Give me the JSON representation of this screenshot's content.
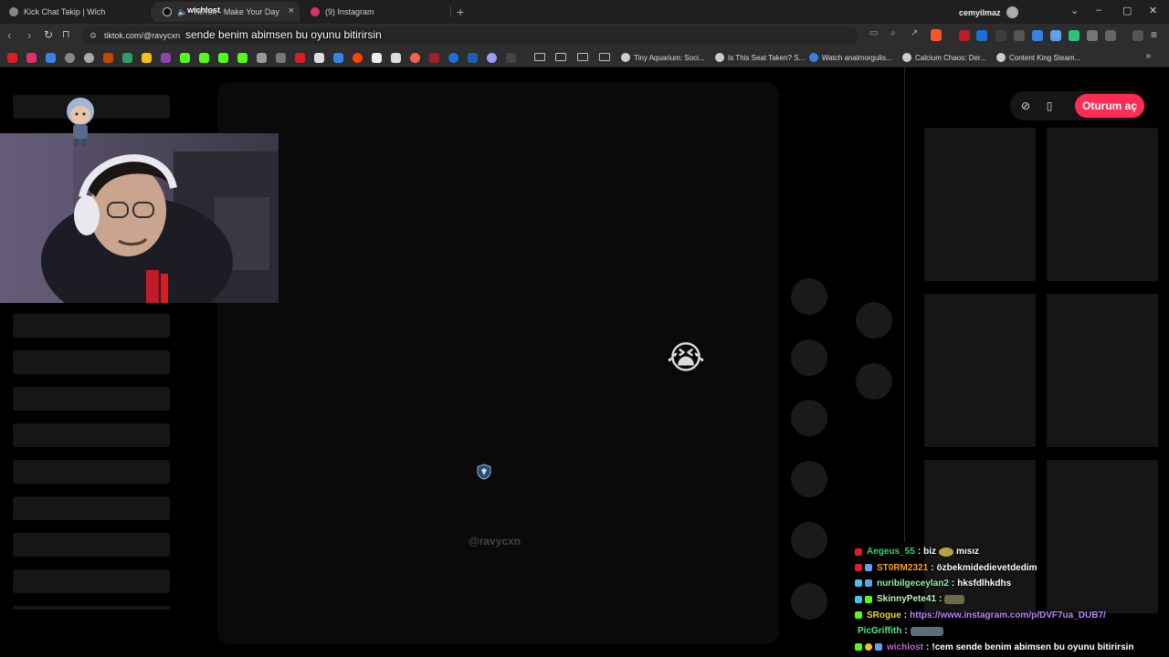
{
  "browser": {
    "tabs": [
      {
        "label": "Kick Chat Takip | Wich",
        "active": false
      },
      {
        "label": "TikTok - Make Your Day",
        "active": true
      },
      {
        "label": "(9) Instagram",
        "active": false
      }
    ],
    "tab_overlay_label": "wichlost",
    "profile_name": "cemyilmaz",
    "url": "tiktok.com/@ravycxn",
    "bookmarks": [
      "Tiny Aquarium: Soci...",
      "Is This Seat Taken? S...",
      "Watch analmorgulis...",
      "Calcium Chaos: Der...",
      "Content King Steam..."
    ]
  },
  "overlay_message": "sende benim abimsen bu oyunu bitirirsin",
  "page": {
    "watermark": "@ravycxn",
    "login_button": "Oturum aç",
    "cry_emoji": "😭"
  },
  "chat": {
    "messages": [
      {
        "user": "Aegeus_55",
        "user_color": "#33d17a",
        "text": "biz",
        "emote": true,
        "text2": "mısız",
        "badges": [
          "#e01b24"
        ]
      },
      {
        "user": "ST0RM2321",
        "user_color": "#ff9f1c",
        "text": "özbekmidedievetdedim",
        "badges": [
          "#e01b24",
          "#62a0ea"
        ]
      },
      {
        "user": "nuribilgeceylan2",
        "user_color": "#8ff0a4",
        "text": "hksfdlhkdhs",
        "badges": [
          "#3fc6e8",
          "#62a0ea"
        ]
      },
      {
        "user": "SkinnyPete41",
        "user_color": "#c0f0c0",
        "text": "",
        "emote": true,
        "badges": [
          "#3fc6e8",
          "#53fc18"
        ]
      },
      {
        "user": "SRogue",
        "user_color": "#f6d32d",
        "link": "https://www.instagram.com/p/DVF7ua_DUB7/",
        "badges": [
          "#53fc18"
        ]
      },
      {
        "user": "PicGriffith",
        "user_color": "#57e389",
        "text": "",
        "emote_wide": true,
        "badges": []
      },
      {
        "user": "wichlost",
        "user_color": "#c061cb",
        "text": "!cem sende benim abimsen bu oyunu bitirirsin",
        "badges": [
          "#53fc18",
          "#f5c211",
          "#62a0ea"
        ]
      }
    ]
  },
  "colors": {
    "accent": "#fe2c55",
    "kick_green": "#53fc18"
  }
}
